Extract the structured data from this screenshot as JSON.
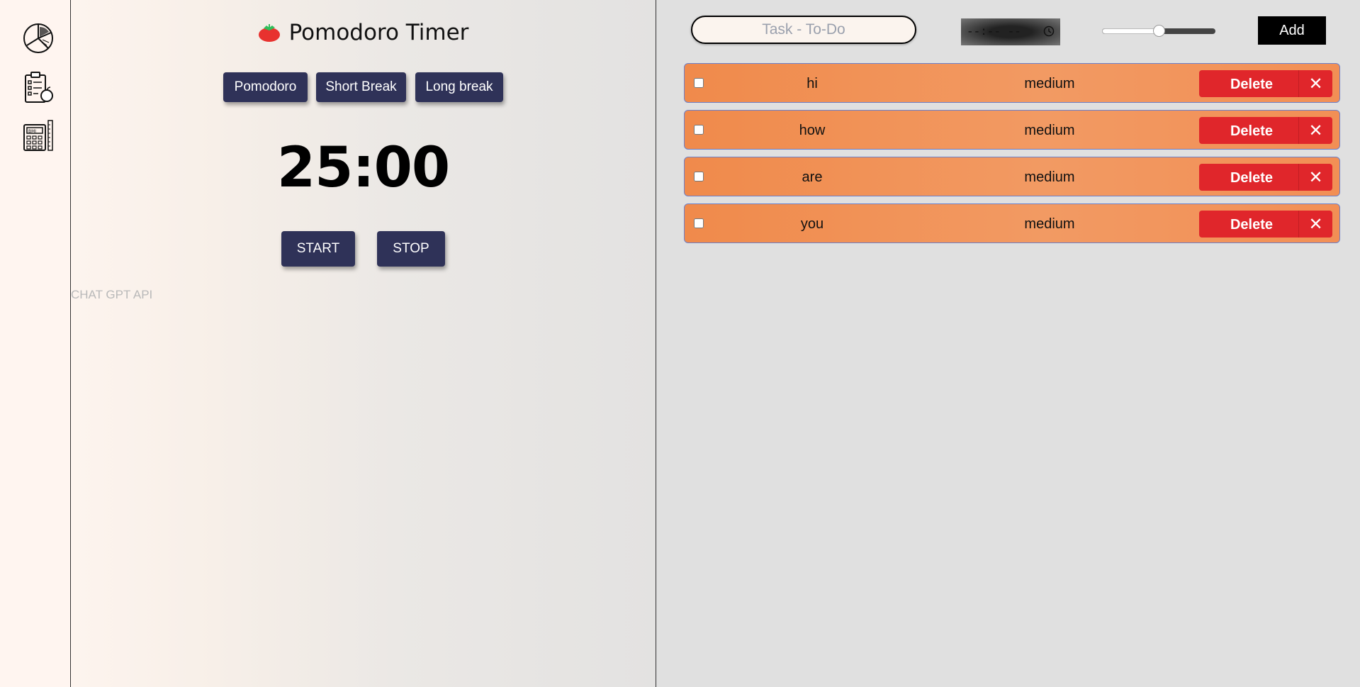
{
  "sidebar": {
    "icons": [
      {
        "name": "pie-chart-icon"
      },
      {
        "name": "checklist-apple-icon"
      },
      {
        "name": "bmi-calculator-icon"
      }
    ]
  },
  "timer": {
    "title": "Pomodoro Timer",
    "icon": "tomato-icon",
    "modes": [
      "Pomodoro",
      "Short Break",
      "Long break"
    ],
    "clock": "25:00",
    "start_label": "START",
    "stop_label": "STOP",
    "chat_link": "CHAT GPT API"
  },
  "todo": {
    "task_placeholder": "Task - To-Do",
    "time_value": "--:-- --",
    "priority_slider_value": 0.5,
    "add_label": "Add",
    "tasks": [
      {
        "name": "hi",
        "priority": "medium",
        "delete_label": "Delete",
        "close": "✕"
      },
      {
        "name": "how",
        "priority": "medium",
        "delete_label": "Delete",
        "close": "✕"
      },
      {
        "name": "are",
        "priority": "medium",
        "delete_label": "Delete",
        "close": "✕"
      },
      {
        "name": "you",
        "priority": "medium",
        "delete_label": "Delete",
        "close": "✕"
      }
    ]
  },
  "colors": {
    "button_navy": "#2f3258",
    "task_orange": "#f08a4b",
    "delete_red": "#e0262b"
  }
}
